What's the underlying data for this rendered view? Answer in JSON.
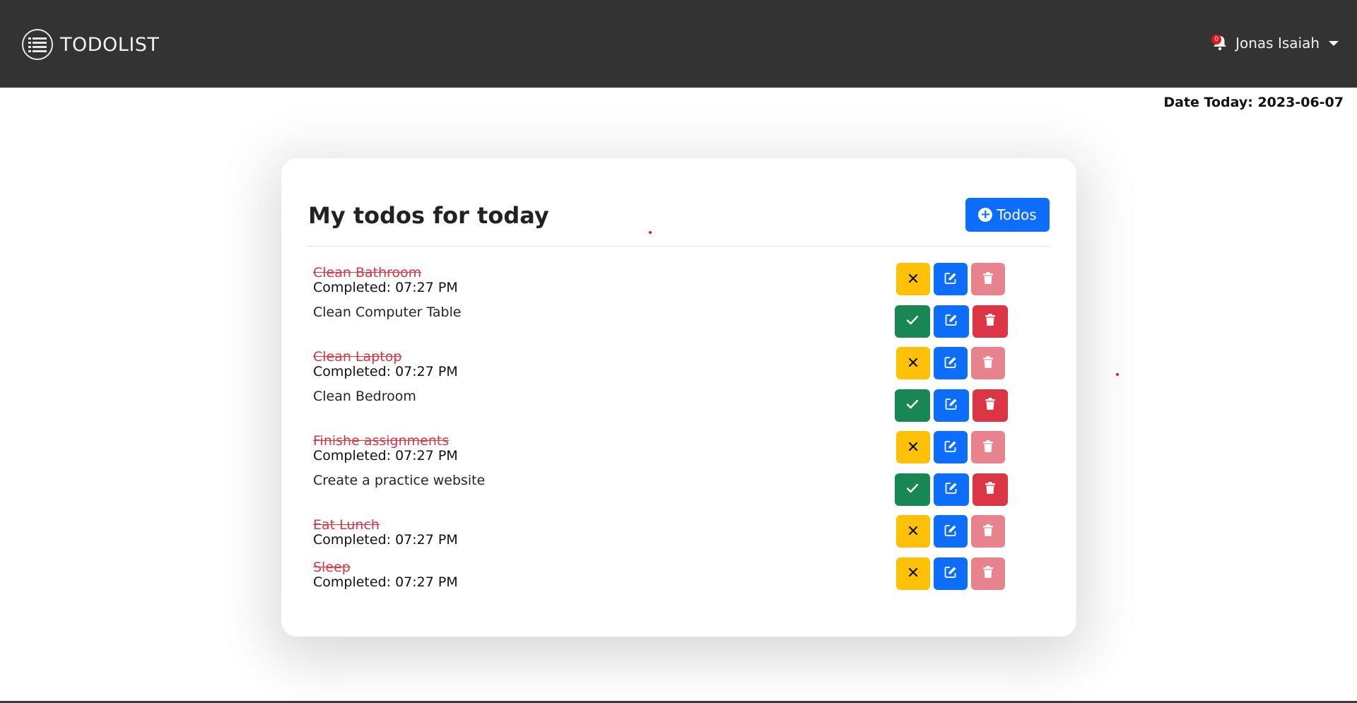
{
  "navbar": {
    "brand": "TODOLIST",
    "notification_count": "0",
    "user_name": "Jonas Isaiah"
  },
  "date_today": "Date Today: 2023-06-07",
  "card": {
    "title": "My todos for today",
    "add_button_label": "Todos"
  },
  "todos": [
    {
      "title": "Clean Bathroom",
      "status": "completed",
      "completed_label": "Completed: 07:27 PM"
    },
    {
      "title": "Clean Computer Table",
      "status": "open",
      "completed_label": ""
    },
    {
      "title": "Clean Laptop",
      "status": "completed",
      "completed_label": "Completed: 07:27 PM"
    },
    {
      "title": "Clean Bedroom",
      "status": "open",
      "completed_label": ""
    },
    {
      "title": "Finishe assignments",
      "status": "completed",
      "completed_label": "Completed: 07:27 PM"
    },
    {
      "title": "Create a practice website",
      "status": "open",
      "completed_label": ""
    },
    {
      "title": "Eat Lunch",
      "status": "completed",
      "completed_label": "Completed: 07:27 PM"
    },
    {
      "title": "Sleep",
      "status": "completed",
      "completed_label": "Completed: 07:27 PM"
    }
  ],
  "colors": {
    "navbar": "#333333",
    "primary": "#0d6efd",
    "warning": "#ffc107",
    "success": "#198754",
    "danger": "#dc3545",
    "danger_disabled": "#e8838d",
    "completed_text": "#dc3545"
  },
  "icons": {
    "brand": "list-circle-icon",
    "notification": "bell-icon",
    "add": "plus-circle-icon",
    "undo": "x-icon",
    "complete": "check-icon",
    "edit": "edit-icon",
    "delete": "trash-icon"
  }
}
